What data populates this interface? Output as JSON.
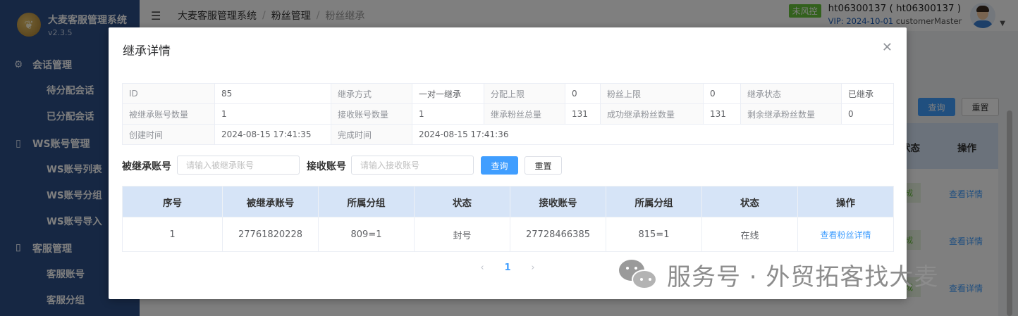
{
  "sidebar": {
    "app_title": "大麦客服管理系统",
    "version": "v2.3.5",
    "groups": [
      {
        "label": "会话管理",
        "icon": "chip-icon",
        "items": [
          "待分配会话",
          "已分配会话"
        ]
      },
      {
        "label": "WS账号管理",
        "icon": "phone-icon",
        "items": [
          "WS账号列表",
          "WS账号分组",
          "WS账号导入"
        ]
      },
      {
        "label": "客服管理",
        "icon": "bookmark-icon",
        "items": [
          "客服账号",
          "客服分组"
        ]
      }
    ]
  },
  "header": {
    "breadcrumb": [
      "大麦客服管理系统",
      "粉丝管理",
      "粉丝继承"
    ],
    "risk_badge": "未风控",
    "user_name": "ht06300137 ( ht06300137 )",
    "vip": "VIP: 2024-10-01",
    "role": "customerMaster"
  },
  "background": {
    "query_label": "查询",
    "reset_label": "重置",
    "col_status": "状态",
    "col_op": "操作",
    "link_label": "查看详情"
  },
  "modal": {
    "title": "继承详情",
    "info_rows": [
      [
        {
          "label": "ID",
          "value": "85"
        },
        {
          "label": "继承方式",
          "value": "一对一继承"
        },
        {
          "label": "分配上限",
          "value": "0"
        },
        {
          "label": "粉丝上限",
          "value": "0"
        },
        {
          "label": "继承状态",
          "value": "已继承"
        }
      ],
      [
        {
          "label": "被继承账号数量",
          "value": "1"
        },
        {
          "label": "接收账号数量",
          "value": "1"
        },
        {
          "label": "继承粉丝总量",
          "value": "131"
        },
        {
          "label": "成功继承粉丝数量",
          "value": "131"
        },
        {
          "label": "剩余继承粉丝数量",
          "value": "0"
        }
      ],
      [
        {
          "label": "创建时间",
          "value": "2024-08-15 17:41:35"
        },
        {
          "label": "完成时间",
          "value": "2024-08-15 17:41:36"
        }
      ]
    ],
    "filter": {
      "source_label": "被继承账号",
      "source_placeholder": "请输入被继承账号",
      "target_label": "接收账号",
      "target_placeholder": "请输入接收账号",
      "query_label": "查询",
      "reset_label": "重置"
    },
    "table": {
      "columns": [
        "序号",
        "被继承账号",
        "所属分组",
        "状态",
        "接收账号",
        "所属分组",
        "状态",
        "操作"
      ],
      "rows": [
        [
          "1",
          "27761820228",
          "809=1",
          "封号",
          "27728466385",
          "815=1",
          "在线",
          "查看粉丝详情"
        ]
      ]
    },
    "pagination": {
      "prev": "‹",
      "current": "1",
      "next": "›"
    }
  },
  "watermark": "服务号 · 外贸拓客找大麦"
}
